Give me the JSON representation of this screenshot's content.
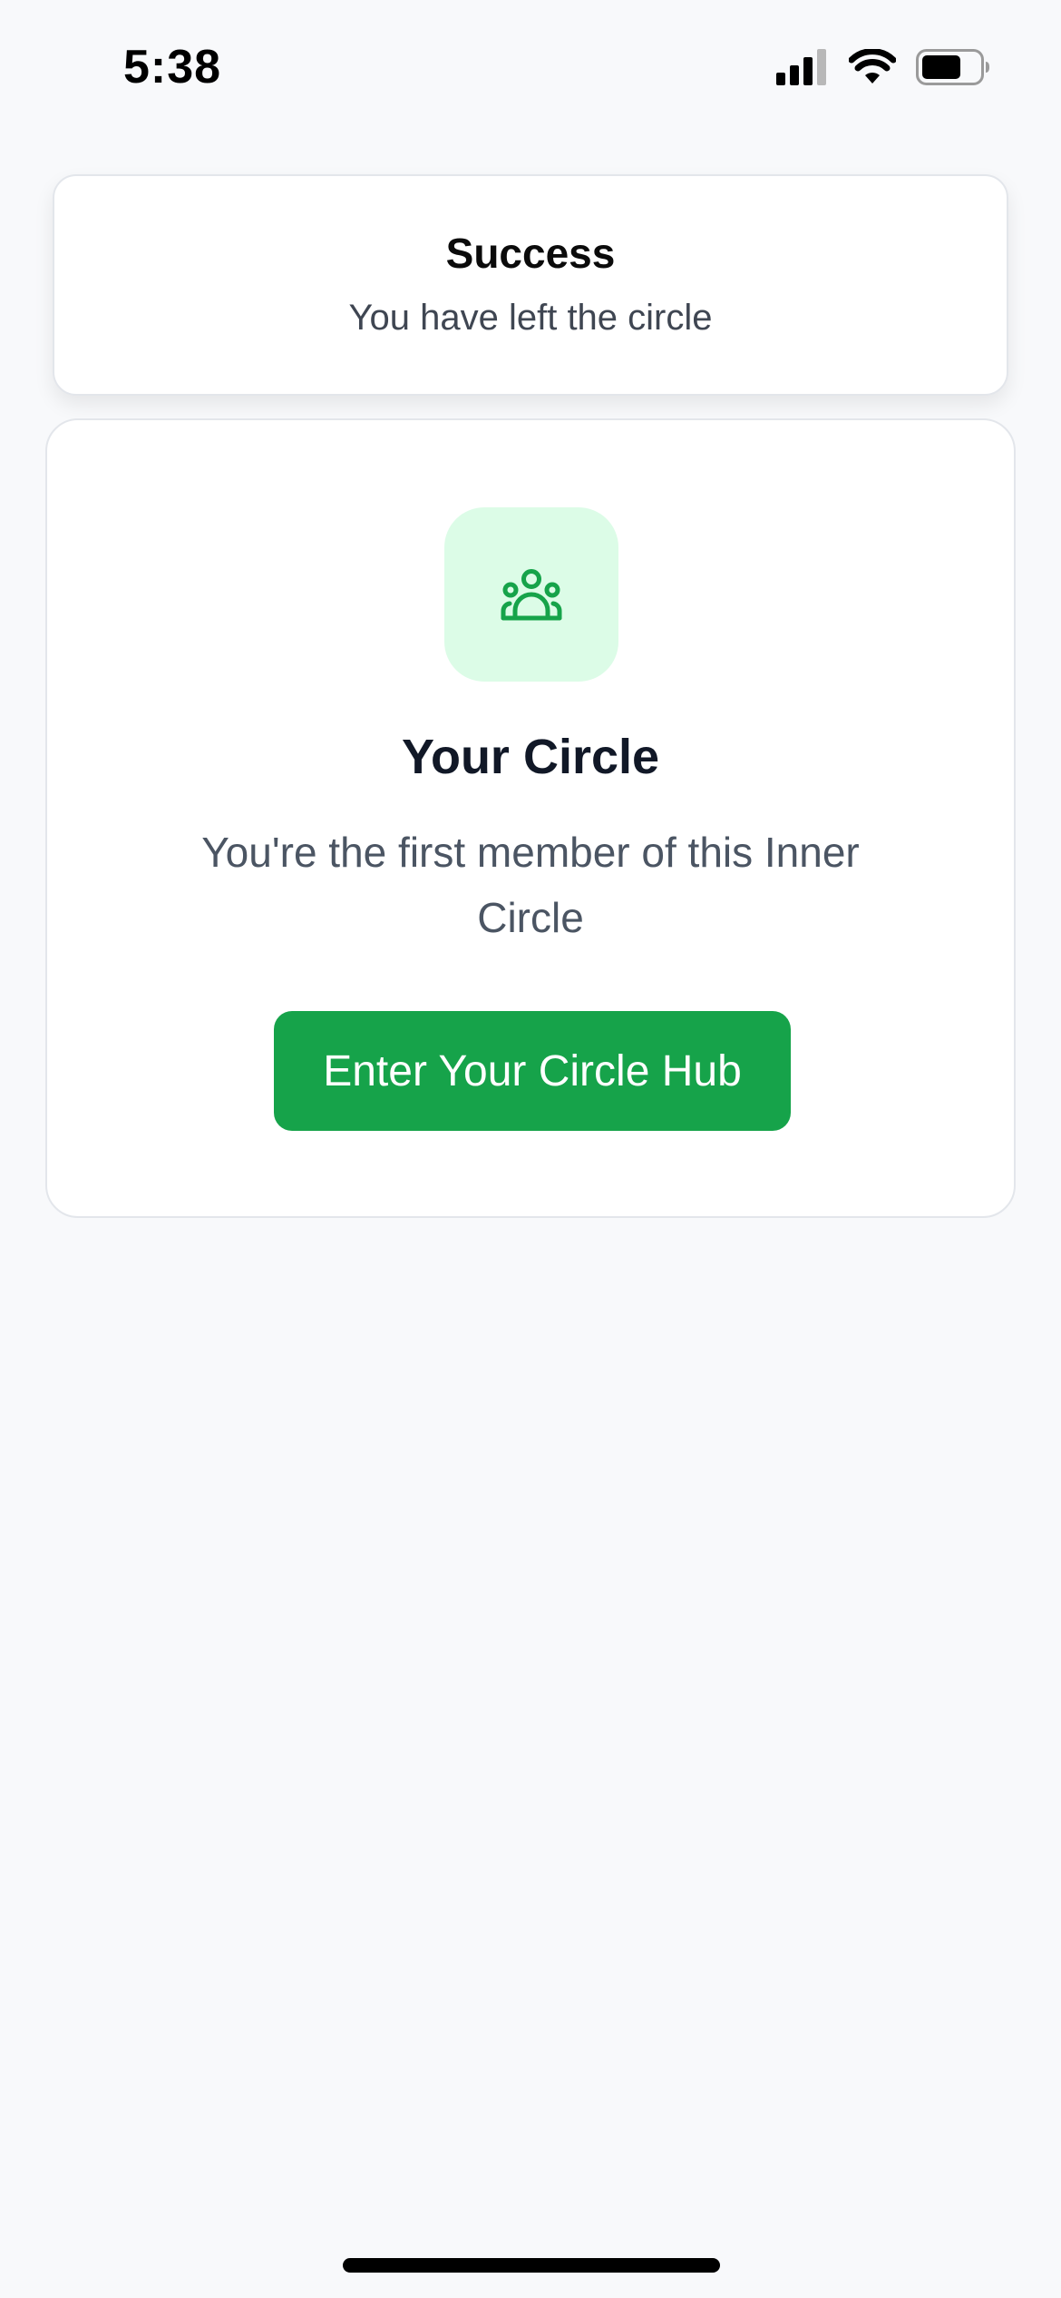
{
  "status_bar": {
    "time": "5:38",
    "icons": [
      "cellular-signal-icon",
      "wifi-icon",
      "battery-icon"
    ]
  },
  "toast": {
    "title": "Success",
    "message": "You have left the circle"
  },
  "circle_card": {
    "icon": "users-group-icon",
    "title": "Your Circle",
    "description": "You're the first member of this Inner Circle",
    "button_label": "Enter Your Circle Hub"
  },
  "colors": {
    "accent": "#16a34a",
    "icon_tile_bg": "#dcfce7",
    "page_bg": "#f8f9fb"
  }
}
